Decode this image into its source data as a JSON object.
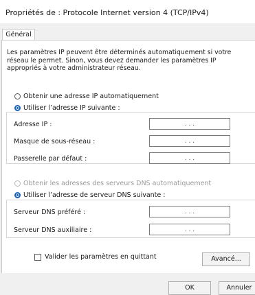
{
  "window": {
    "title": "Propriétés de : Protocole Internet version 4 (TCP/IPv4)"
  },
  "tabs": [
    {
      "label": "Général"
    }
  ],
  "description": "Les paramètres IP peuvent être déterminés automatiquement si votre réseau le permet. Sinon, vous devez demander les paramètres IP appropriés à votre administrateur réseau.",
  "ip": {
    "auto_label": "Obtenir une adresse IP automatiquement",
    "manual_label": "Utiliser l’adresse IP suivante :",
    "fields": [
      {
        "label": "Adresse IP :",
        "value": ". . ."
      },
      {
        "label": "Masque de sous-réseau :",
        "value": ". . ."
      },
      {
        "label": "Passerelle par défaut :",
        "value": ". . ."
      }
    ]
  },
  "dns": {
    "auto_label": "Obtenir les adresses des serveurs DNS automatiquement",
    "manual_label": "Utiliser l’adresse de serveur DNS suivante :",
    "fields": [
      {
        "label": "Serveur DNS préféré :",
        "value": ". . ."
      },
      {
        "label": "Serveur DNS auxiliaire :",
        "value": ". . ."
      }
    ]
  },
  "validate_label": "Valider les paramètres en quittant",
  "buttons": {
    "advanced": "Avancé...",
    "ok": "OK",
    "cancel": "Annuler"
  },
  "colors": {
    "accent": "#1560b8",
    "background": "#f0f0f0",
    "panel": "#ffffff"
  }
}
